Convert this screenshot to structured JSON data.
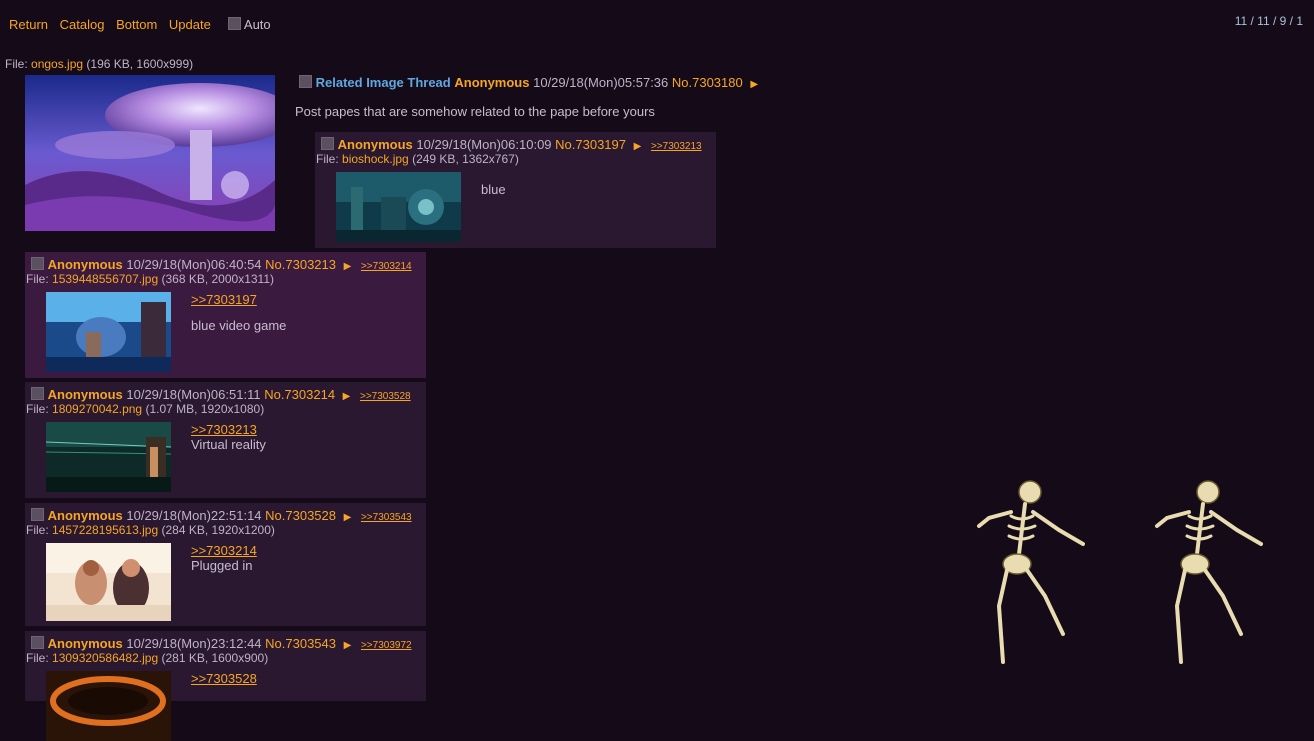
{
  "nav": {
    "return": "Return",
    "catalog": "Catalog",
    "bottom": "Bottom",
    "update": "Update",
    "auto": "Auto"
  },
  "counts": "11 / 11 / 9 / 1",
  "op": {
    "file_prefix": "File:",
    "file_name": "ongos.jpg",
    "file_info": "(196 KB, 1600x999)",
    "subject": "Related Image Thread",
    "name": "Anonymous",
    "date": "10/29/18(Mon)05:57:36",
    "no": "No.7303180",
    "text": "Post papes that are somehow related to the pape before yours"
  },
  "replies": [
    {
      "name": "Anonymous",
      "date": "10/29/18(Mon)06:10:09",
      "no": "No.7303197",
      "backlink": ">>7303213",
      "file_prefix": "File:",
      "file_name": "bioshock.jpg",
      "file_info": "(249 KB, 1362x767)",
      "quote": "",
      "text": "blue"
    },
    {
      "name": "Anonymous",
      "date": "10/29/18(Mon)06:40:54",
      "no": "No.7303213",
      "backlink": ">>7303214",
      "file_prefix": "File:",
      "file_name": "1539448556707.jpg",
      "file_info": "(368 KB, 2000x1311)",
      "quote": ">>7303197",
      "text": "blue video game"
    },
    {
      "name": "Anonymous",
      "date": "10/29/18(Mon)06:51:11",
      "no": "No.7303214",
      "backlink": ">>7303528",
      "file_prefix": "File:",
      "file_name": "1809270042.png",
      "file_info": "(1.07 MB, 1920x1080)",
      "quote": ">>7303213",
      "text": "Virtual reality"
    },
    {
      "name": "Anonymous",
      "date": "10/29/18(Mon)22:51:14",
      "no": "No.7303528",
      "backlink": ">>7303543",
      "file_prefix": "File:",
      "file_name": "1457228195613.jpg",
      "file_info": "(284 KB, 1920x1200)",
      "quote": ">>7303214",
      "text": "Plugged in"
    },
    {
      "name": "Anonymous",
      "date": "10/29/18(Mon)23:12:44",
      "no": "No.7303543",
      "backlink": ">>7303972",
      "file_prefix": "File:",
      "file_name": "1309320586482.jpg",
      "file_info": "(281 KB, 1600x900)",
      "quote": ">>7303528",
      "text": ""
    }
  ],
  "colors": {
    "background": "#150b18",
    "accent": "#f5a623",
    "subject": "#5fa8e0",
    "reply_bg": "#2a1730",
    "reply_highlight_bg": "#3b1a3f"
  },
  "icons": [
    "checkbox-icon",
    "arrow-right-icon",
    "dancing-skeleton-icon"
  ]
}
